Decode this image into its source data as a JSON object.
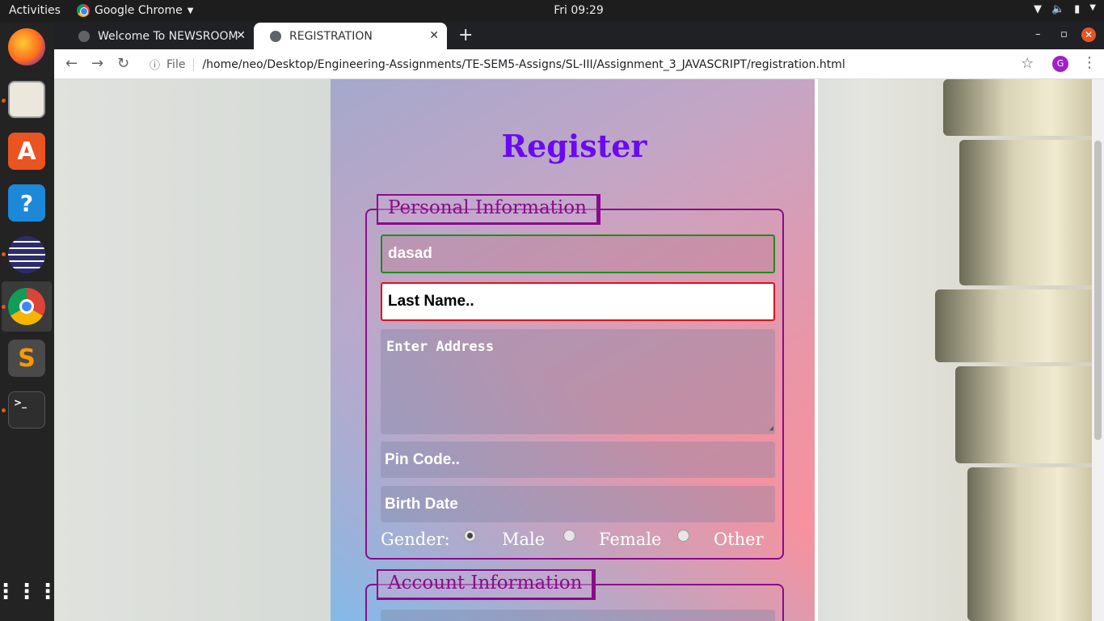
{
  "system": {
    "activities": "Activities",
    "app_name": "Google Chrome",
    "clock": "Fri 09:29"
  },
  "browser": {
    "tabs": [
      {
        "title": "Welcome To NEWSROOM",
        "active": false
      },
      {
        "title": "REGISTRATION",
        "active": true
      }
    ],
    "url_scheme_label": "File",
    "url": "/home/neo/Desktop/Engineering-Assignments/TE-SEM5-Assigns/SL-III/Assignment_3_JAVASCRIPT/registration.html",
    "profile_initial": "G"
  },
  "page": {
    "title": "Register",
    "personal_legend": "Personal Information",
    "first_name_value": "dasad",
    "last_name_placeholder": "Last Name..",
    "address_placeholder": "Enter Address",
    "pin_placeholder": "Pin Code..",
    "birth_placeholder": "Birth Date",
    "gender_label": "Gender:",
    "gender_options": [
      "Male",
      "Female",
      "Other"
    ],
    "gender_selected": "Male",
    "account_legend": "Account Information"
  },
  "colors": {
    "title": "#6a0af0",
    "legend": "#8a0b8a",
    "valid_border": "#1a8f1a",
    "invalid_border": "#e0101a"
  }
}
